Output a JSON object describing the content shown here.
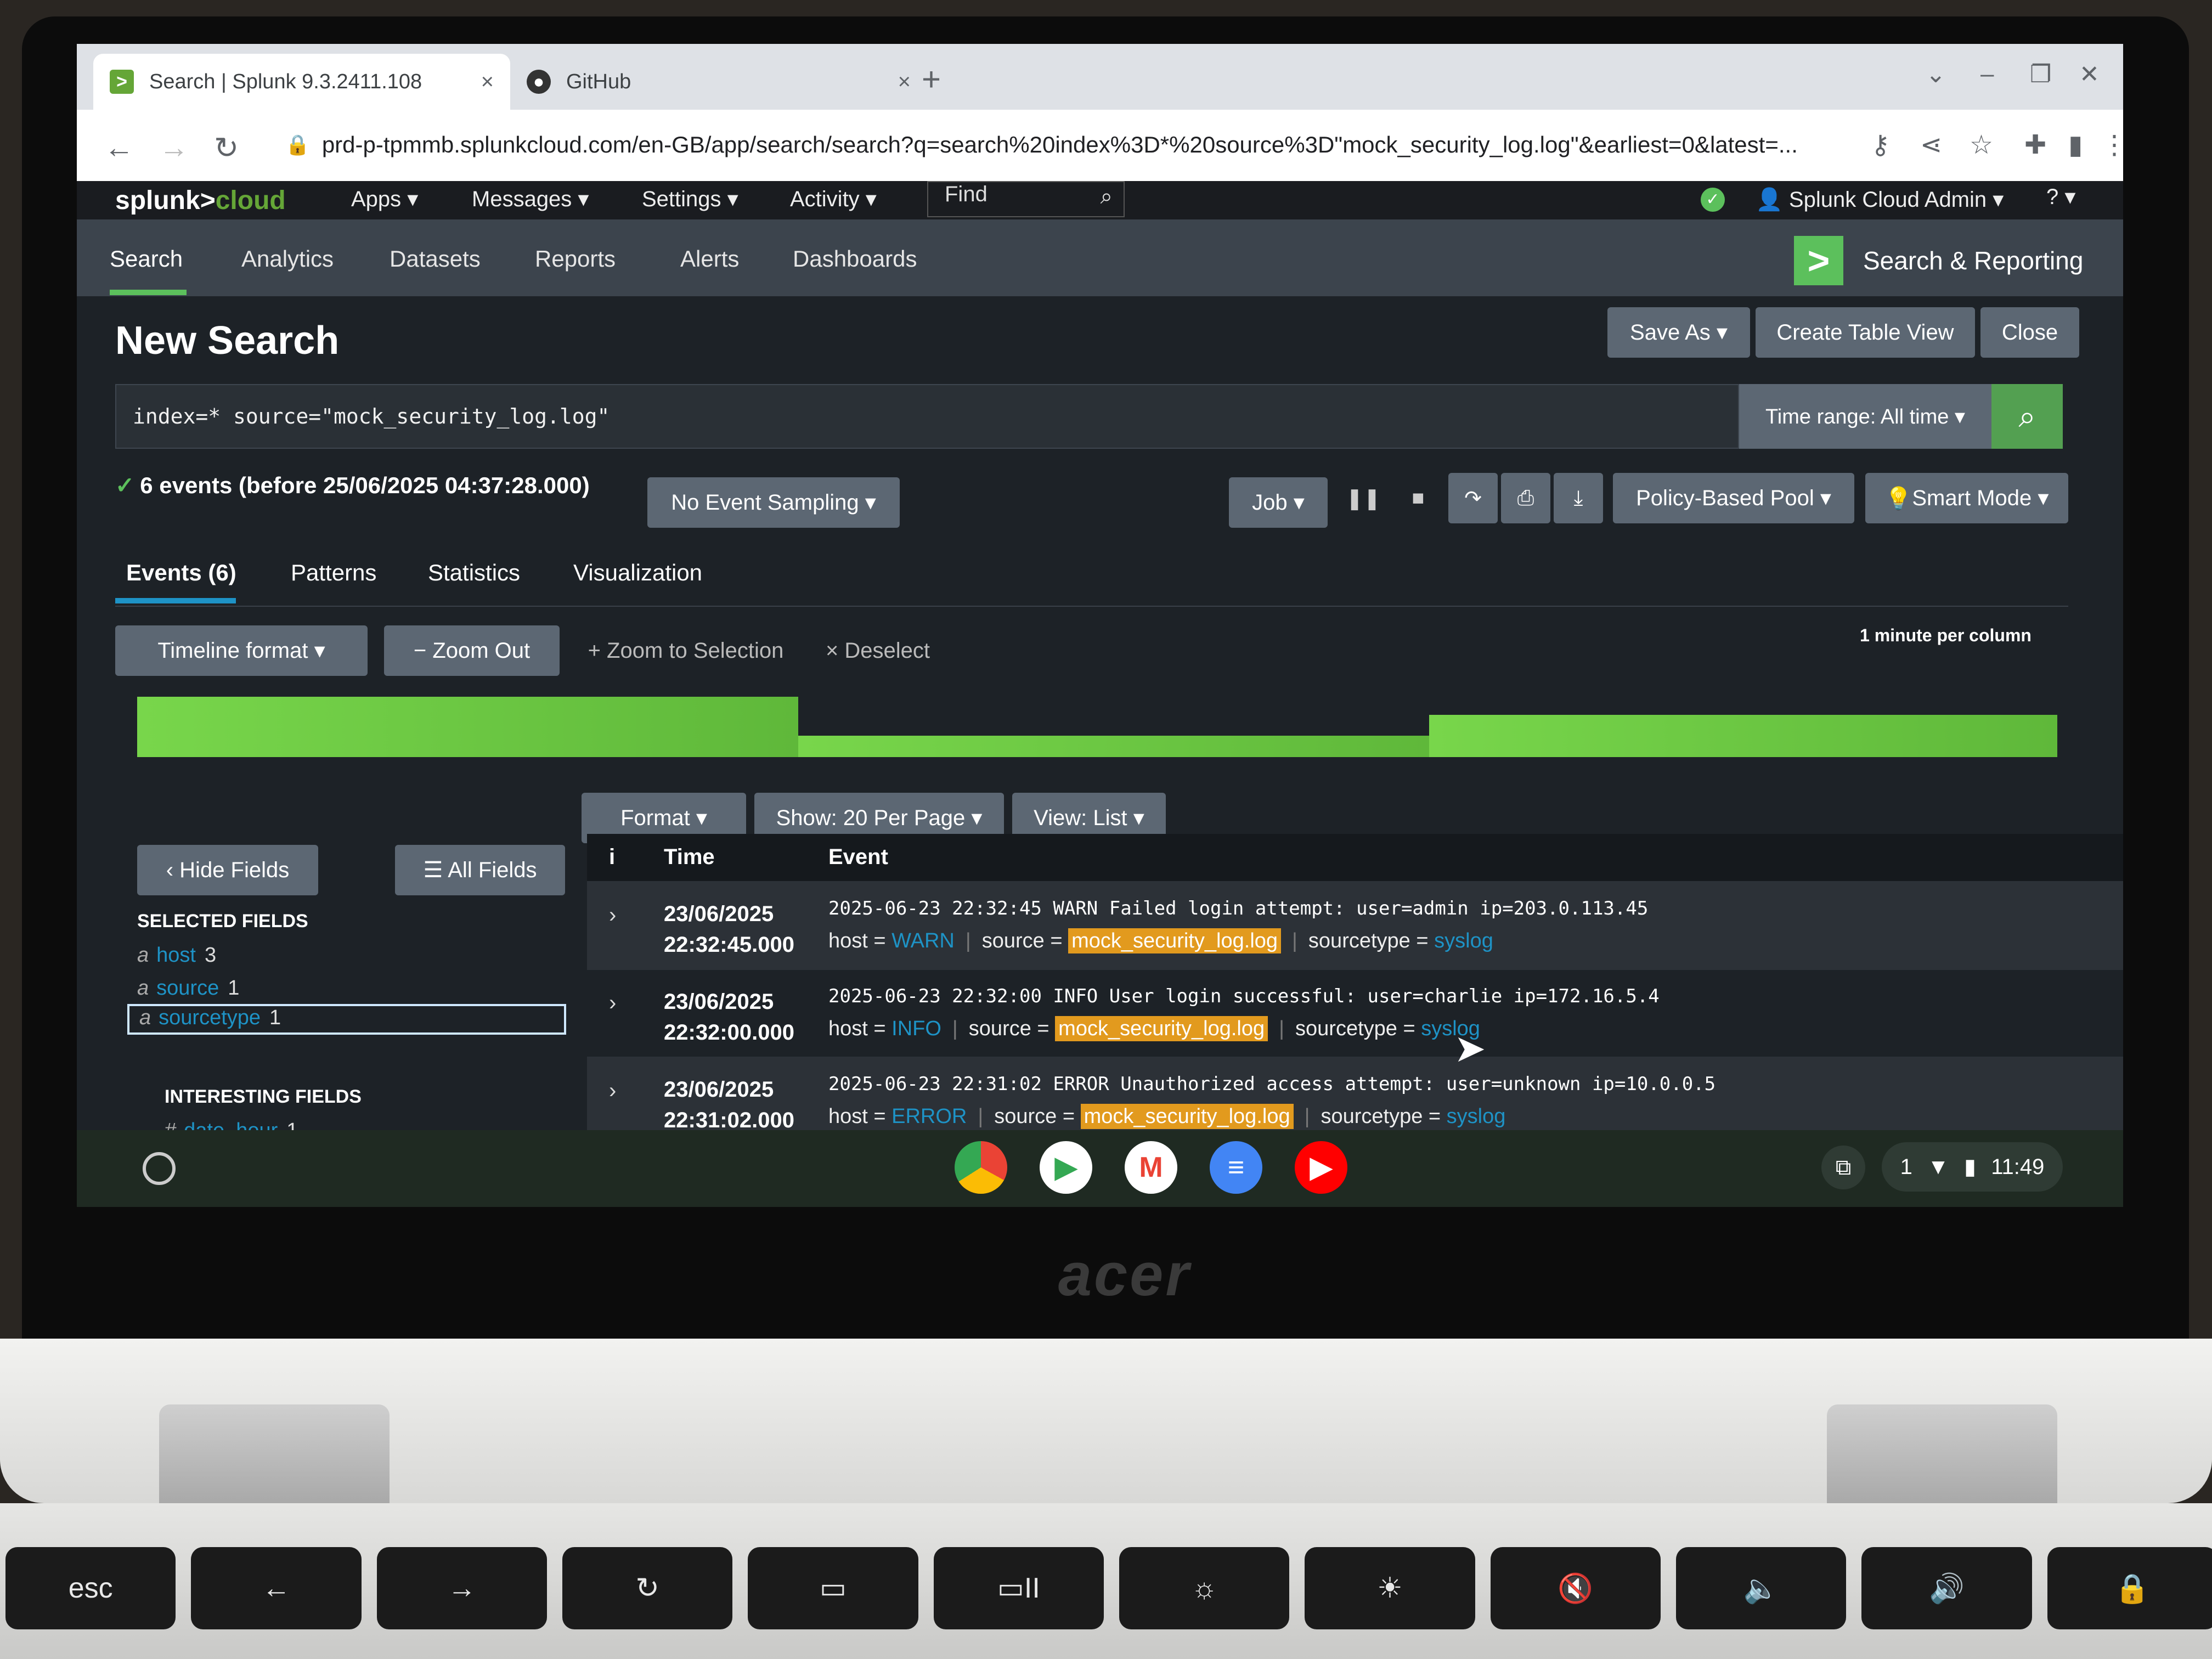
{
  "browser": {
    "tabs": [
      {
        "title": "Search | Splunk 9.3.2411.108",
        "close": "×"
      },
      {
        "title": "GitHub",
        "close": "×"
      }
    ],
    "new_tab": "+",
    "url": "prd-p-tpmmb.splunkcloud.com/en-GB/app/search/search?q=search%20index%3D*%20source%3D\"mock_security_log.log\"&earliest=0&latest=..."
  },
  "splunk_bar": {
    "logo_a": "splunk>",
    "logo_b": "cloud",
    "menus": [
      "Apps ▾",
      "Messages ▾",
      "Settings ▾",
      "Activity ▾"
    ],
    "find": "Find",
    "user": "Splunk Cloud Admin ▾",
    "help": "? ▾"
  },
  "app_nav": {
    "items": [
      "Search",
      "Analytics",
      "Datasets",
      "Reports",
      "Alerts",
      "Dashboards"
    ],
    "app_name": "Search & Reporting"
  },
  "page": {
    "title": "New Search",
    "save_as": "Save As ▾",
    "create_table": "Create Table View",
    "close": "Close",
    "query": "index=* source=\"mock_security_log.log\"",
    "time_range": "Time range: All time ▾",
    "status": "6 events (before 25/06/2025 04:37:28.000)",
    "sampling": "No Event Sampling ▾",
    "job": "Job ▾",
    "pool": "Policy-Based Pool ▾",
    "mode": "Smart Mode ▾"
  },
  "subtabs": [
    "Events (6)",
    "Patterns",
    "Statistics",
    "Visualization"
  ],
  "timeline": {
    "format": "Timeline format ▾",
    "zoom_out": "− Zoom Out",
    "zoom_sel": "+ Zoom to Selection",
    "deselect": "× Deselect",
    "per_column": "1 minute per column",
    "levels": [
      1.0,
      0.35,
      0.7
    ]
  },
  "results_bar": {
    "format": "Format ▾",
    "per_page": "Show: 20 Per Page ▾",
    "view": "View: List ▾"
  },
  "fields": {
    "hide": "‹ Hide Fields",
    "all": "☰ All Fields",
    "selected_header": "SELECTED FIELDS",
    "selected": [
      {
        "type": "a",
        "name": "host",
        "count": "3"
      },
      {
        "type": "a",
        "name": "source",
        "count": "1"
      },
      {
        "type": "a",
        "name": "sourcetype",
        "count": "1"
      }
    ],
    "interesting_header": "INTERESTING FIELDS",
    "interesting": [
      {
        "type": "#",
        "name": "date_hour",
        "count": "1"
      }
    ]
  },
  "table": {
    "col_i": "i",
    "col_time": "Time",
    "col_event": "Event",
    "rows": [
      {
        "date": "23/06/2025",
        "time": "22:32:45.000",
        "raw": "2025-06-23 22:32:45 WARN Failed login attempt: user=admin ip=203.0.113.45",
        "host": "WARN",
        "source": "mock_security_log.log",
        "sourcetype": "syslog"
      },
      {
        "date": "23/06/2025",
        "time": "22:32:00.000",
        "raw": "2025-06-23 22:32:00 INFO User login successful: user=charlie ip=172.16.5.4",
        "host": "INFO",
        "source": "mock_security_log.log",
        "sourcetype": "syslog"
      },
      {
        "date": "23/06/2025",
        "time": "22:31:02.000",
        "raw": "2025-06-23 22:31:02 ERROR Unauthorized access attempt: user=unknown ip=10.0.0.5",
        "host": "ERROR",
        "source": "mock_security_log.log",
        "sourcetype": "syslog"
      }
    ],
    "host_label": "host =",
    "source_label": "source =",
    "sourcetype_label": "sourcetype ="
  },
  "shelf": {
    "clock": "11:49",
    "notif_count": "1"
  },
  "device": {
    "brand": "acer",
    "keys": [
      "esc",
      "←",
      "→",
      "↻",
      "▭",
      "▭II",
      "☼",
      "☀",
      "🔇",
      "🔈",
      "🔊",
      "🔒"
    ]
  }
}
